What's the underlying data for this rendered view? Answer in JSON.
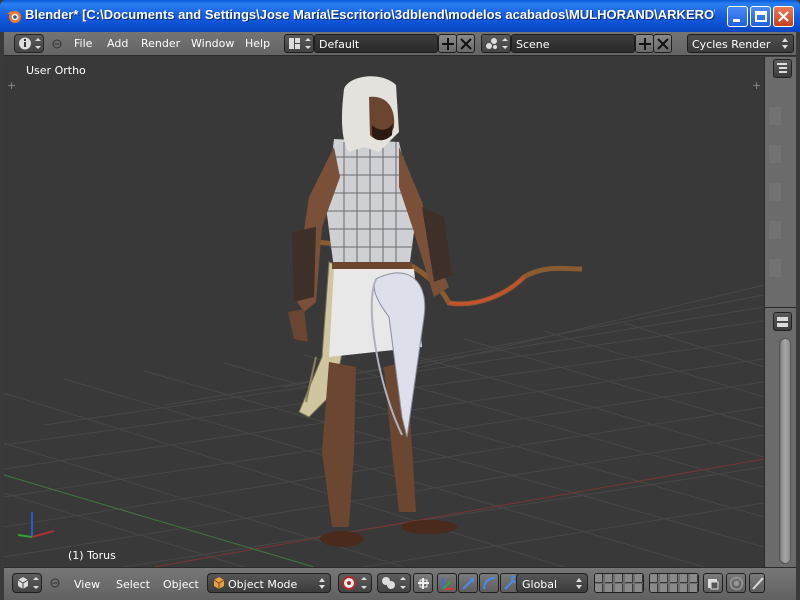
{
  "window": {
    "title": "Blender* [C:\\Documents and Settings\\Jose María\\Escritorio\\3dblend\\modelos acabados\\MULHORAND\\ARKERO\\t..."
  },
  "info_header": {
    "menus": [
      "File",
      "Add",
      "Render",
      "Window",
      "Help"
    ],
    "screen_layout": "Default",
    "scene": "Scene",
    "render_engine": "Cycles Render"
  },
  "viewport": {
    "view_label": "User Ortho",
    "object_label": "(1) Torus"
  },
  "view_header": {
    "menus": [
      "View",
      "Select",
      "Object"
    ],
    "mode": "Object Mode",
    "orientation": "Global"
  },
  "colors": {
    "viewport_bg": "#393939",
    "grid": "#4a4a4a",
    "x_axis": "#8a3030",
    "y_axis": "#3c8a3c",
    "title_bar": "#1761e2"
  }
}
